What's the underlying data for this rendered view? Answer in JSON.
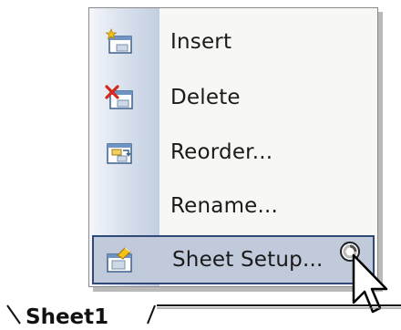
{
  "context_menu": {
    "items": [
      {
        "label": "Insert",
        "icon": "insert-sheet-icon",
        "highlighted": false
      },
      {
        "label": "Delete",
        "icon": "delete-sheet-icon",
        "highlighted": false
      },
      {
        "label": "Reorder...",
        "icon": "reorder-sheets-icon",
        "highlighted": false
      },
      {
        "label": "Rename...",
        "icon": "",
        "highlighted": false
      },
      {
        "label": "Sheet Setup...",
        "icon": "sheet-setup-icon",
        "highlighted": true
      }
    ]
  },
  "sheet_tabs": {
    "active_tab": "Sheet1"
  },
  "colors": {
    "menu_background": "#f7f7f4",
    "menu_gutter": "#c3cfe1",
    "highlight_fill": "#c1cadb",
    "highlight_border": "#2f4a78"
  }
}
